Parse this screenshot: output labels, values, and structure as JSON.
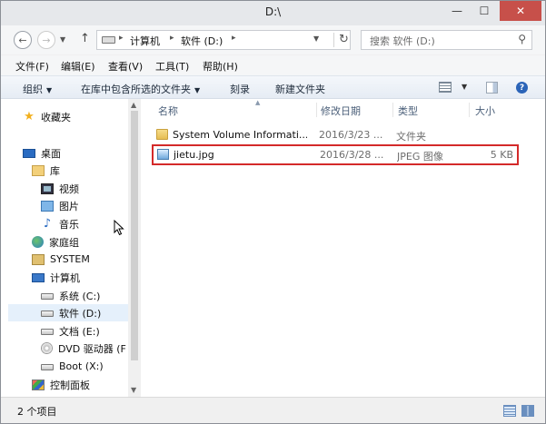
{
  "window": {
    "title": "D:\\",
    "min_glyph": "—",
    "max_glyph": "☐",
    "close_glyph": "✕"
  },
  "address": {
    "crumbs": [
      "计算机",
      "软件 (D:)"
    ],
    "search_placeholder": "搜索 软件 (D:)"
  },
  "menu": [
    "文件(F)",
    "编辑(E)",
    "查看(V)",
    "工具(T)",
    "帮助(H)"
  ],
  "toolbar": {
    "organize": "组织",
    "include_in_library": "在库中包含所选的文件夹",
    "burn": "刻录",
    "new_folder": "新建文件夹",
    "help_glyph": "?"
  },
  "nav": {
    "favorites": "收藏夹",
    "desktop": "桌面",
    "libraries": "库",
    "videos": "视频",
    "pictures": "图片",
    "music": "音乐",
    "homegroup": "家庭组",
    "user": "SYSTEM",
    "computer": "计算机",
    "drive_c": "系统 (C:)",
    "drive_d": "软件 (D:)",
    "drive_e": "文档 (E:)",
    "drive_f": "DVD 驱动器 (F",
    "drive_x": "Boot (X:)",
    "control_panel": "控制面板"
  },
  "columns": {
    "name": "名称",
    "date": "修改日期",
    "type": "类型",
    "size": "大小"
  },
  "files": [
    {
      "name": "System Volume Informati...",
      "date": "2016/3/23 ...",
      "type": "文件夹",
      "size": ""
    },
    {
      "name": "jietu.jpg",
      "date": "2016/3/28 ...",
      "type": "JPEG 图像",
      "size": "5 KB"
    }
  ],
  "status": {
    "item_count": "2 个项目"
  },
  "colors": {
    "highlight_outline": "#d42a2a",
    "selected_nav": "#e5f0fb",
    "close_button": "#c7504a"
  }
}
